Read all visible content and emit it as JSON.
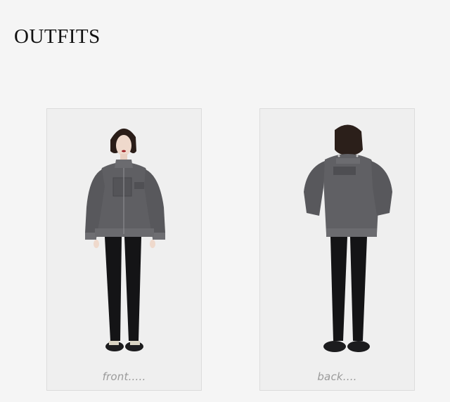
{
  "page": {
    "title": "OUTFITS"
  },
  "outfits": [
    {
      "caption": "front....."
    },
    {
      "caption": "back...."
    }
  ]
}
